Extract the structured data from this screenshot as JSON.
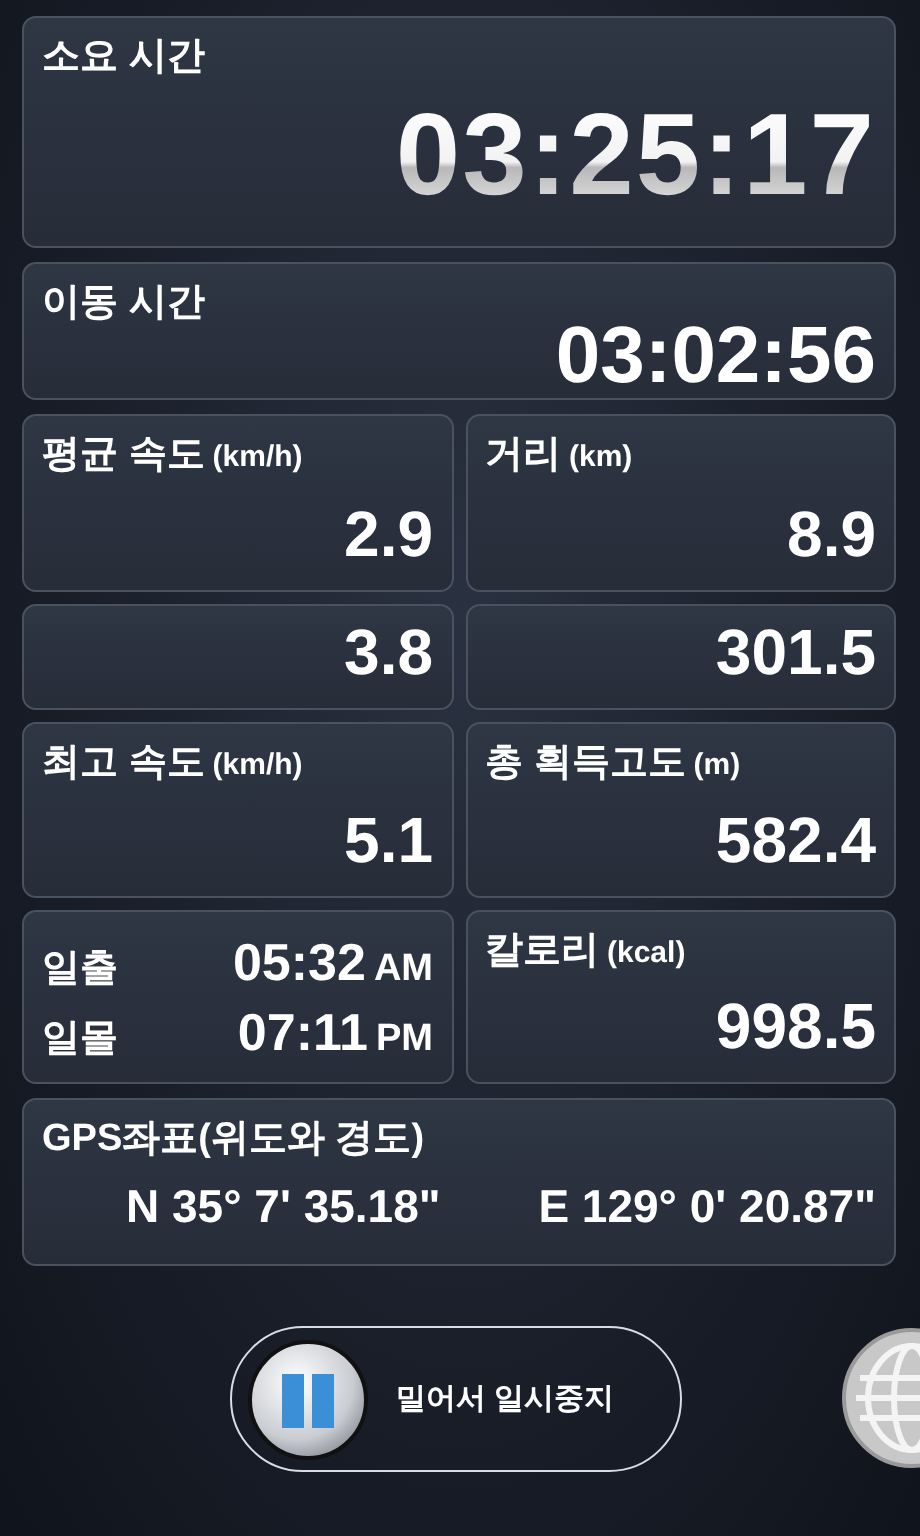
{
  "elapsed": {
    "label": "소요 시간",
    "value": "03:25:17"
  },
  "moving": {
    "label": "이동 시간",
    "value": "03:02:56"
  },
  "stats": [
    {
      "label": "평균 속도",
      "unit": "(km/h)",
      "value": "2.9"
    },
    {
      "label": "거리",
      "unit": "(km)",
      "value": "8.9"
    },
    {
      "value": "3.8"
    },
    {
      "value": "301.5"
    },
    {
      "label": "최고 속도",
      "unit": "(km/h)",
      "value": "5.1"
    },
    {
      "label": "총 획득고도",
      "unit": "(m)",
      "value": "582.4"
    }
  ],
  "sun": [
    {
      "label": "일출",
      "time": "05:32",
      "period": "AM"
    },
    {
      "label": "일몰",
      "time": "07:11",
      "period": "PM"
    }
  ],
  "calories": {
    "label": "칼로리",
    "unit": "(kcal)",
    "value": "998.5"
  },
  "gps": {
    "label": "GPS좌표(위도와 경도)",
    "latitude": "N 35° 7' 35.18\"",
    "longitude": "E 129° 0' 20.87\""
  },
  "pause_slider": {
    "label": "밀어서 일시중지",
    "level": 0
  }
}
